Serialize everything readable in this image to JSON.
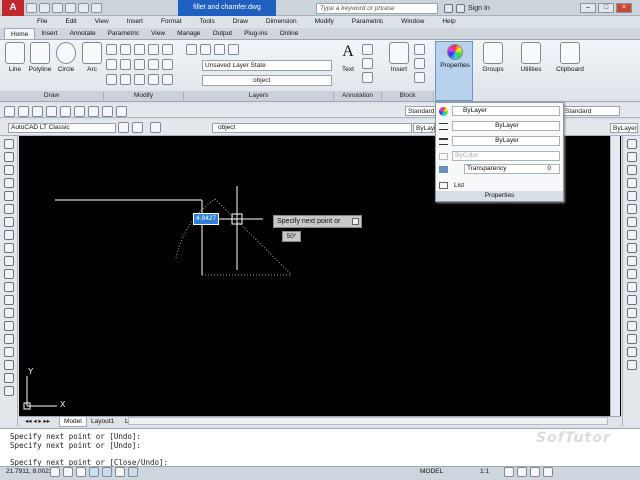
{
  "titlebar": {
    "doc_title": "fillet and chamfer.dwg",
    "search_placeholder": "Type a keyword or phrase",
    "sign_in": "Sign In"
  },
  "menu": [
    "File",
    "Edit",
    "View",
    "Insert",
    "Format",
    "Tools",
    "Draw",
    "Dimension",
    "Modify",
    "Parametric",
    "Window",
    "Help"
  ],
  "ribbon_tabs": [
    "Home",
    "Insert",
    "Annotate",
    "Parametric",
    "View",
    "Manage",
    "Output",
    "Plug-ins",
    "Online"
  ],
  "ribbon": {
    "draw_tools": [
      "Line",
      "Polyline",
      "Circle",
      "Arc"
    ],
    "big_tools": [
      "Text",
      "Insert",
      "Properties",
      "Groups",
      "Utilities",
      "Clipboard"
    ],
    "layer_state": "Unsaved Layer State",
    "layer_name": "object",
    "panels": [
      "Draw",
      "Modify",
      "Layers",
      "Annotation",
      "Block"
    ]
  },
  "toolbar": {
    "workspace": "AutoCAD LT Classic",
    "layer": "object",
    "style": "Standard",
    "bylayer": "ByLayer"
  },
  "properties_dropdown": {
    "color": "ByLayer",
    "linetype": "ByLayer",
    "lineweight": "ByLayer",
    "plotstyle": "ByColor",
    "transparency": "Transparency",
    "transparency_value": "0",
    "list": "List",
    "footer": "Properties"
  },
  "canvas": {
    "dynamic_input": "4.9427",
    "tooltip": "Specify next point or",
    "angle": "50°"
  },
  "layout_tabs": [
    "Model",
    "Layout1",
    "Layout2"
  ],
  "command_lines": [
    "Specify next point or [Undo]:",
    "Specify next point or [Undo]:",
    "",
    "Specify next point or [Close/Undo]:"
  ],
  "watermark": "SofTutor",
  "status": {
    "coords": "21.7911, 8.0023",
    "model": "MODEL",
    "scale": "1:1"
  }
}
